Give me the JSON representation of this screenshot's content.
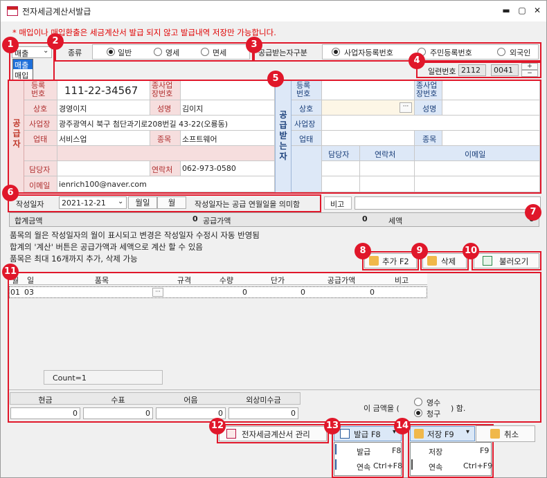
{
  "window": {
    "title": "전자세금계산서발급",
    "minimize": "▬",
    "maximize": "▢",
    "close": "✕"
  },
  "notice": "* 매입이나 매입환출은 세금계산서 발급 되지 않고 발급내역 저장만 가능합니다.",
  "badges": [
    "1",
    "2",
    "3",
    "4",
    "5",
    "6",
    "7",
    "8",
    "9",
    "10",
    "11",
    "12",
    "13",
    "14"
  ],
  "trade_type": {
    "selected": "매출",
    "options": [
      "매출",
      "매입"
    ]
  },
  "kind": {
    "label": "종류",
    "options": [
      "일반",
      "영세",
      "면세"
    ],
    "selected": "일반"
  },
  "receiver_type": {
    "label": "공급받는자구분",
    "options": [
      "사업자등록번호",
      "주민등록번호",
      "외국인"
    ],
    "selected": "사업자등록번호"
  },
  "serial": {
    "label": "일련번호",
    "year": "2112",
    "number": "0041",
    "plus": "+",
    "minus": "−"
  },
  "supplier": {
    "section": "공급자",
    "reg_no_label": "등록번호",
    "reg_no": "111-22-34567",
    "sub_no_label": "종사업장번호",
    "name_label": "상호",
    "name": "경영이지",
    "ceo_label": "성명",
    "ceo": "김이지",
    "addr_label": "사업장",
    "addr": "광주광역시 북구 첨단과기로208번길 43-22(오룡동)",
    "biz_label": "업태",
    "biz": "서비스업",
    "item_label": "종목",
    "item": "소프트웨어",
    "manager_label": "담당자",
    "contact_label": "연락처",
    "contact": "062-973-0580",
    "email_label": "이메일",
    "email": "ienrich100@naver.com"
  },
  "receiver": {
    "section": "공급받는자",
    "reg_no_label": "등록번호",
    "sub_no_label": "종사업장번호",
    "name_label": "상호",
    "ceo_label": "성명",
    "addr_label": "사업장",
    "biz_label": "업태",
    "item_label": "종목",
    "manager_label": "담당자",
    "contact_label": "연락처",
    "email_label": "이메일",
    "lookup": "···"
  },
  "write_date": {
    "label": "작성일자",
    "value": "2021-12-21",
    "month_end": "월일",
    "month": "월",
    "hint": "작성일자는 공급 연월일을 의미함",
    "memo_label": "비고"
  },
  "totals": {
    "total_label": "합계금액",
    "total": "0",
    "supply_label": "공급가액",
    "supply": "0",
    "tax_label": "세액",
    "tax": "0"
  },
  "help_lines": [
    "품목의 월은 작성일자의 월이 표시되고 변경은 작성일자 수정시 자동 반영됨",
    "합계의 '계산' 버튼은 공급가액과 세액으로 계산 할 수 있음",
    "품목은 최대 16개까지 추가, 삭제 가능"
  ],
  "item_buttons": {
    "add": "추가 F2",
    "delete": "삭제",
    "load": "불러오기"
  },
  "items_table": {
    "headers": [
      "월",
      "일",
      "품목",
      "규격",
      "수량",
      "단가",
      "공급가액",
      "비고"
    ],
    "rows": [
      {
        "month": "01",
        "day": "03",
        "item": "",
        "spec": "",
        "qty": "0",
        "price": "0",
        "supply": "0",
        "memo": ""
      }
    ],
    "lookup": "···",
    "count": "Count=1"
  },
  "payment": {
    "headers": [
      "현금",
      "수표",
      "어음",
      "외상미수금"
    ],
    "values": [
      "0",
      "0",
      "0",
      "0"
    ],
    "sentence_pre": "이 금액을 (",
    "sentence_post": ") 함.",
    "options": [
      "영수",
      "청구"
    ],
    "selected": "청구"
  },
  "bottom_buttons": {
    "manage": "전자세금계산서 관리",
    "issue": "발급 F8",
    "save": "저장 F9",
    "cancel": "취소"
  },
  "issue_menu": [
    {
      "label": "발급",
      "key": "F8"
    },
    {
      "label": "연속",
      "key": "Ctrl+F8"
    }
  ],
  "save_menu": [
    {
      "label": "저장",
      "key": "F9"
    },
    {
      "label": "연속",
      "key": "Ctrl+F9"
    }
  ],
  "colors": {
    "accent_red": "#e0172a",
    "notice_red": "#e00000",
    "supplier_pink": "#f6dede",
    "receiver_blue": "#dde8f7",
    "selection_blue": "#1e6fd9"
  }
}
